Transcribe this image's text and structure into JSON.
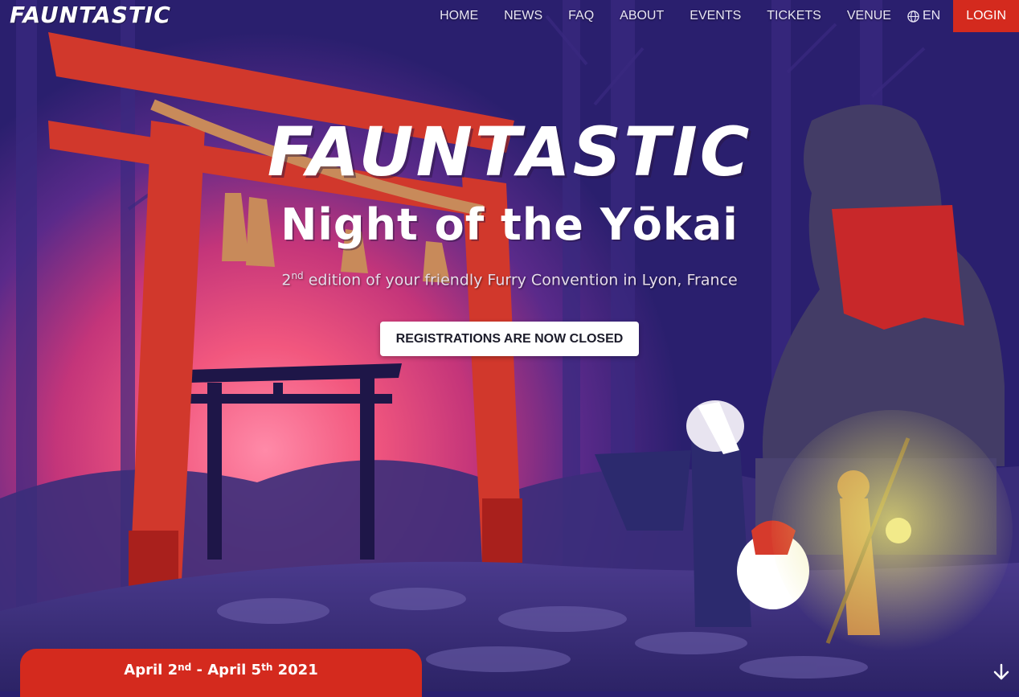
{
  "brand": {
    "name": "FAUNTASTIC"
  },
  "nav": {
    "items": [
      "HOME",
      "NEWS",
      "FAQ",
      "ABOUT",
      "EVENTS",
      "TICKETS",
      "VENUE"
    ],
    "language": "EN",
    "login": "LOGIN"
  },
  "hero": {
    "title": "FAUNTASTIC",
    "subtitle": "Night of the Yōkai",
    "tagline_ordinal": "2",
    "tagline_suffix": "nd",
    "tagline_rest": " edition of your friendly Furry Convention in Lyon, France",
    "cta": "REGISTRATIONS ARE NOW CLOSED"
  },
  "dates": {
    "start_month": "April 2",
    "start_suffix": "nd",
    "separator": " - ",
    "end_month": "April 5",
    "end_suffix": "th",
    "year": " 2021"
  },
  "icons": {
    "globe": "globe-icon",
    "scroll_down": "arrow-down-icon"
  },
  "colors": {
    "accent_red": "#d42a1e",
    "sky_purple": "#2a1f6e",
    "sunset_pink": "#f2577e"
  }
}
